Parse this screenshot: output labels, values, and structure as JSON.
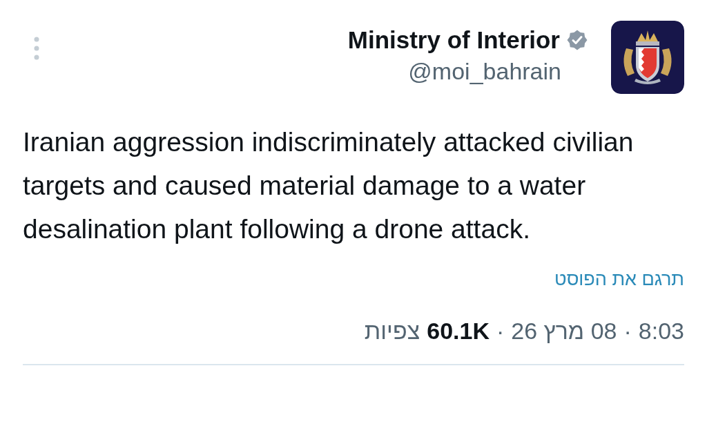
{
  "author": {
    "name": "Ministry of Interior",
    "verified": true,
    "handle": "@moi_bahrain"
  },
  "post": {
    "text": "Iranian aggression indiscriminately attacked civilian targets and caused material damage to a water desalination plant following a drone attack."
  },
  "translate_link": "תרגם את הפוסט",
  "meta": {
    "time": "8:03",
    "separator": "·",
    "date": "08 מרץ 26",
    "views_count": "60.1K",
    "views_label": "צפיות"
  }
}
